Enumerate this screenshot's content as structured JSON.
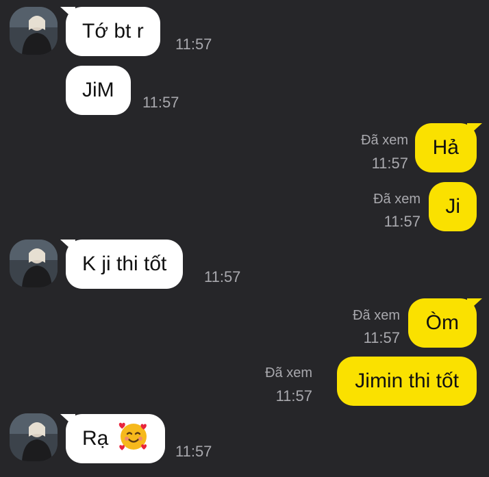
{
  "messages": [
    {
      "side": "in",
      "text": "Tớ bt r",
      "time": "11:57",
      "avatar": "contact-avatar"
    },
    {
      "side": "in",
      "text": "JiM",
      "time": "11:57"
    },
    {
      "side": "out",
      "text": "Hả",
      "time": "11:57",
      "status": "Đã xem"
    },
    {
      "side": "out",
      "text": "Ji",
      "time": "11:57",
      "status": "Đã xem"
    },
    {
      "side": "in",
      "text": "K ji thi tốt",
      "time": "11:57",
      "avatar": "contact-avatar"
    },
    {
      "side": "out",
      "text": "Òm",
      "time": "11:57",
      "status": "Đã xem"
    },
    {
      "side": "out",
      "text": "Jimin thi tốt",
      "time": "11:57",
      "status": "Đã xem"
    },
    {
      "side": "in",
      "text": "Rạ",
      "emoji": "smiling-face-with-hearts-emoji",
      "time": "11:57",
      "avatar": "contact-avatar"
    }
  ],
  "colors": {
    "background": "#262629",
    "incoming_bubble": "#ffffff",
    "outgoing_bubble": "#fae100",
    "meta_text": "#a9a9ae"
  }
}
